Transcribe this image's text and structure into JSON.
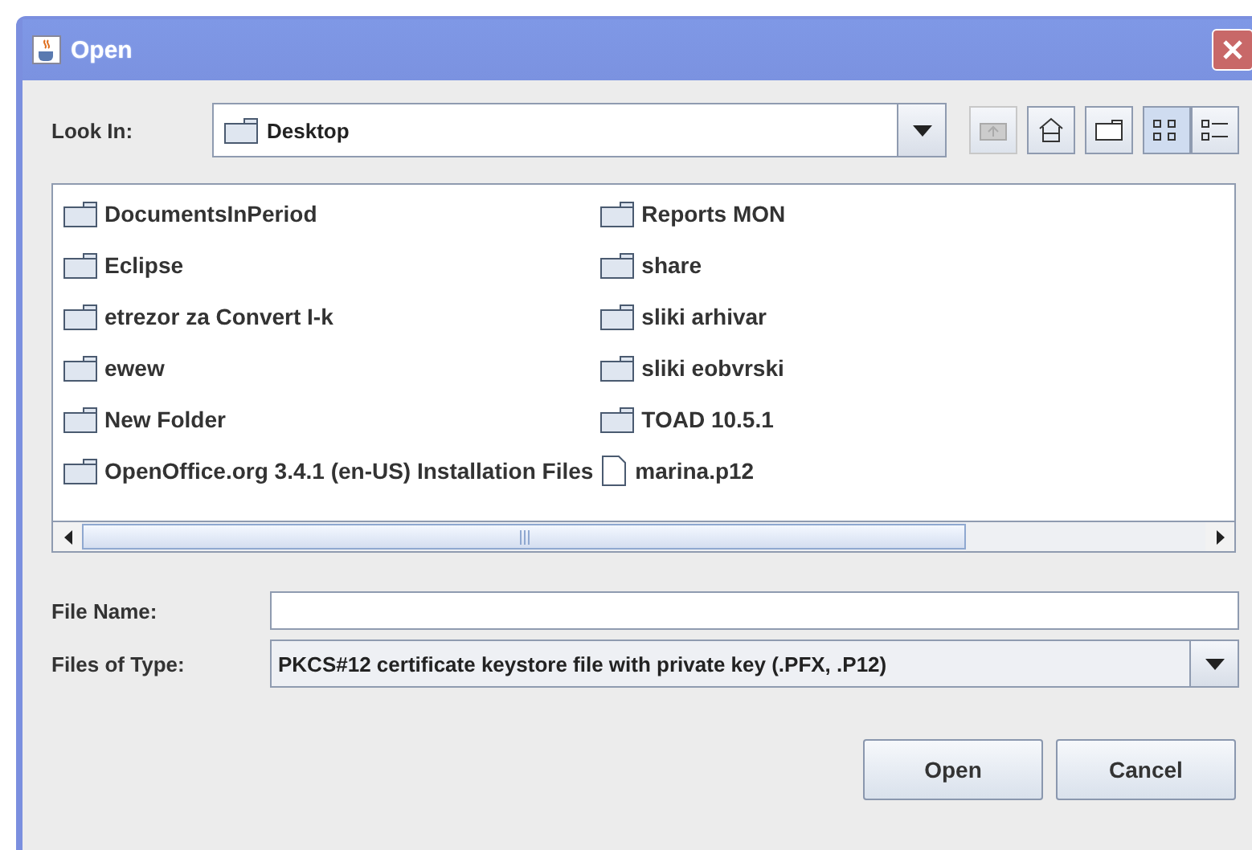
{
  "window": {
    "title": "Open"
  },
  "look_in": {
    "label": "Look In:",
    "value": "Desktop"
  },
  "toolbar": [
    {
      "kind": "up",
      "disabled": true
    },
    {
      "kind": "home",
      "disabled": false
    },
    {
      "kind": "new-folder",
      "disabled": false
    },
    {
      "kind": "list",
      "selected": true
    },
    {
      "kind": "details",
      "selected": false
    }
  ],
  "files": [
    {
      "name": "DocumentsInPeriod",
      "kind": "folder"
    },
    {
      "name": "Eclipse",
      "kind": "folder"
    },
    {
      "name": "etrezor za Convert I-k",
      "kind": "folder"
    },
    {
      "name": "ewew",
      "kind": "folder"
    },
    {
      "name": "New Folder",
      "kind": "folder"
    },
    {
      "name": "OpenOffice.org 3.4.1 (en-US) Installation Files",
      "kind": "folder"
    },
    {
      "name": "Reports MON",
      "kind": "folder"
    },
    {
      "name": "share",
      "kind": "folder"
    },
    {
      "name": "sliki arhivar",
      "kind": "folder"
    },
    {
      "name": "sliki eobvrski",
      "kind": "folder"
    },
    {
      "name": "TOAD 10.5.1",
      "kind": "folder"
    },
    {
      "name": "marina.p12",
      "kind": "file"
    }
  ],
  "file_name": {
    "label": "File Name:"
  },
  "files_of_type": {
    "label": "Files of Type:",
    "value": "PKCS#12 certificate keystore file with private key (.PFX, .P12)"
  },
  "buttons": [
    "Open",
    "Cancel"
  ]
}
